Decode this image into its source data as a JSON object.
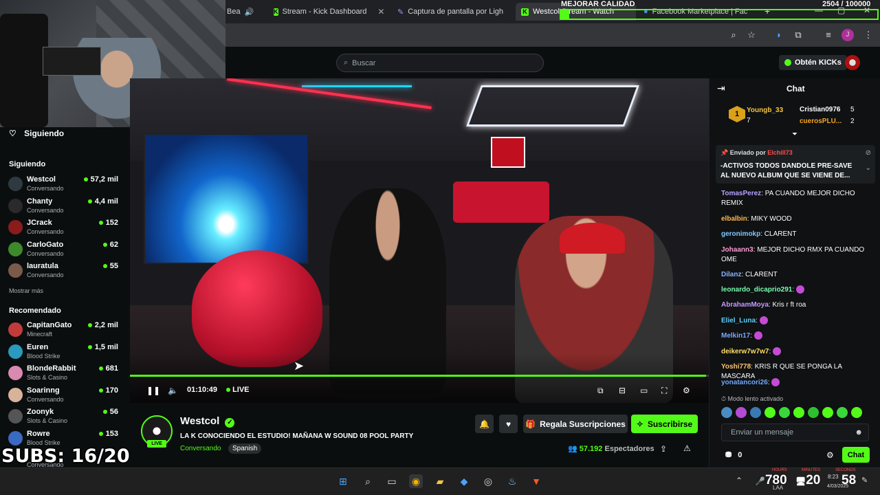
{
  "browser": {
    "tabs": [
      {
        "label": "Bea",
        "active": false
      },
      {
        "label": "Stream - Kick Dashboard",
        "active": false
      },
      {
        "label": "Captura de pantalla por Ligh",
        "active": false
      },
      {
        "label": "Westcol Stream - Watch",
        "active": true
      },
      {
        "label": "Facebook Marketplace | Fac",
        "active": false
      }
    ],
    "profile_initial": "J"
  },
  "overlay": {
    "goal_label": "MEJORAR CALIDAD",
    "goal_value": "2504 / 100000",
    "goal_progress": 0.025,
    "subs_text": "SUBS: 16/20"
  },
  "header": {
    "search_placeholder": "Buscar",
    "get_kicks_label": "Obtén KICKs"
  },
  "sidebar": {
    "following_header": "Siguiendo",
    "following_title": "Siguiendo",
    "following": [
      {
        "name": "Westcol",
        "category": "Conversando",
        "viewers": "57,2 mil",
        "avatar_color": "#2f3a40"
      },
      {
        "name": "Chanty",
        "category": "Conversando",
        "viewers": "4,4 mil",
        "avatar_color": "#2a2a2a"
      },
      {
        "name": "JCrack",
        "category": "Conversando",
        "viewers": "152",
        "avatar_color": "#8a1c1c"
      },
      {
        "name": "CarloGato",
        "category": "Conversando",
        "viewers": "62",
        "avatar_color": "#3c8a2a"
      },
      {
        "name": "lauratula",
        "category": "Conversando",
        "viewers": "55",
        "avatar_color": "#7a5a4a"
      }
    ],
    "show_more": "Mostrar más",
    "recommended_title": "Recomendado",
    "recommended": [
      {
        "name": "CapitanGato",
        "category": "Minecraft",
        "viewers": "2,2 mil",
        "avatar_color": "#c23b3b"
      },
      {
        "name": "Euren",
        "category": "Blood Strike",
        "viewers": "1,5 mil",
        "avatar_color": "#2a9abf"
      },
      {
        "name": "BlondeRabbit",
        "category": "Slots & Casino",
        "viewers": "681",
        "avatar_color": "#d88ab0"
      },
      {
        "name": "Soarinng",
        "category": "Conversando",
        "viewers": "170",
        "avatar_color": "#d9b29a"
      },
      {
        "name": "Zoonyk",
        "category": "Slots & Casino",
        "viewers": "56",
        "avatar_color": "#555"
      },
      {
        "name": "Rowre",
        "category": "Blood Strike",
        "viewers": "153",
        "avatar_color": "#3a6ac2"
      }
    ],
    "last_category": "Conversando"
  },
  "player": {
    "time": "01:10:49",
    "live_label": "LIVE",
    "progress": 0.995
  },
  "stream": {
    "channel": "Westcol",
    "live_badge": "LIVE",
    "title": "LA K CONOCIENDO EL ESTUDIO! MAÑANA W SOUND 08 POOL PARTY",
    "category": "Conversando",
    "language": "Spanish",
    "viewers": "57.192",
    "viewers_label": "Espectadores",
    "gift_label": "Regala Suscripciones",
    "subscribe_label": "Suscribirse"
  },
  "chat": {
    "title": "Chat",
    "leaders": [
      {
        "name": "Youngb_33",
        "count": "7"
      },
      {
        "name": "Cristian0976",
        "count": "5"
      },
      {
        "name": "cuerosPLU...",
        "count": "2"
      }
    ],
    "pinned_by_label": "Enviado por",
    "pinned_user": "Elchill73",
    "pinned_text": "-ACTIVOS TODOS DANDOLE PRE-SAVE AL NUEVO ALBUM QUE SE VIENE DE...",
    "messages": [
      {
        "user": "TomasPerez",
        "color": "#b8a2ff",
        "text": "PA CUANDO MEJOR DICHO REMIX"
      },
      {
        "user": "elbalbin",
        "color": "#ffb84d",
        "text": "MIKY WOOD"
      },
      {
        "user": "geronimokp",
        "color": "#7ec8ff",
        "text": "CLARENT"
      },
      {
        "user": "Johaann3",
        "color": "#ff9ad5",
        "text": "MEJOR DICHO RMX PA CUANDO OME"
      },
      {
        "user": "Dilanz",
        "color": "#8ab4ff",
        "text": "CLARENT"
      },
      {
        "user": "leonardo_dicaprio291",
        "color": "#7affb0",
        "text": ""
      },
      {
        "user": "AbrahamMoya",
        "color": "#c59aff",
        "text": "Kris r ft roa"
      },
      {
        "user": "Eliel_Luna",
        "color": "#5bd0ff",
        "text": ""
      },
      {
        "user": "Melkin17",
        "color": "#7aa8ff",
        "text": ""
      },
      {
        "user": "deikerw7w7w7",
        "color": "#ffe066",
        "text": ""
      },
      {
        "user": "Yoshi778",
        "color": "#ffc46b",
        "text": "KRIS R QUE SE PONGA LA MASCARA"
      },
      {
        "user": "yonatancori26",
        "color": "#6fa8ff",
        "text": ""
      }
    ],
    "slow_mode": "Modo lento activado",
    "input_placeholder": "Enviar un mensaje",
    "kicks_count": "0",
    "chat_button": "Chat"
  },
  "taskbar": {
    "tray_left_value": "780",
    "tray_mid_value": "20",
    "tray_right_value": "58",
    "time": "8:23",
    "date": "4/03/2025",
    "counter_labels": [
      "HOURS",
      "MINUTES",
      "SECONDS"
    ],
    "lang": "LAA"
  },
  "colors": {
    "accent": "#53fc18",
    "background": "#0b0e0f"
  }
}
